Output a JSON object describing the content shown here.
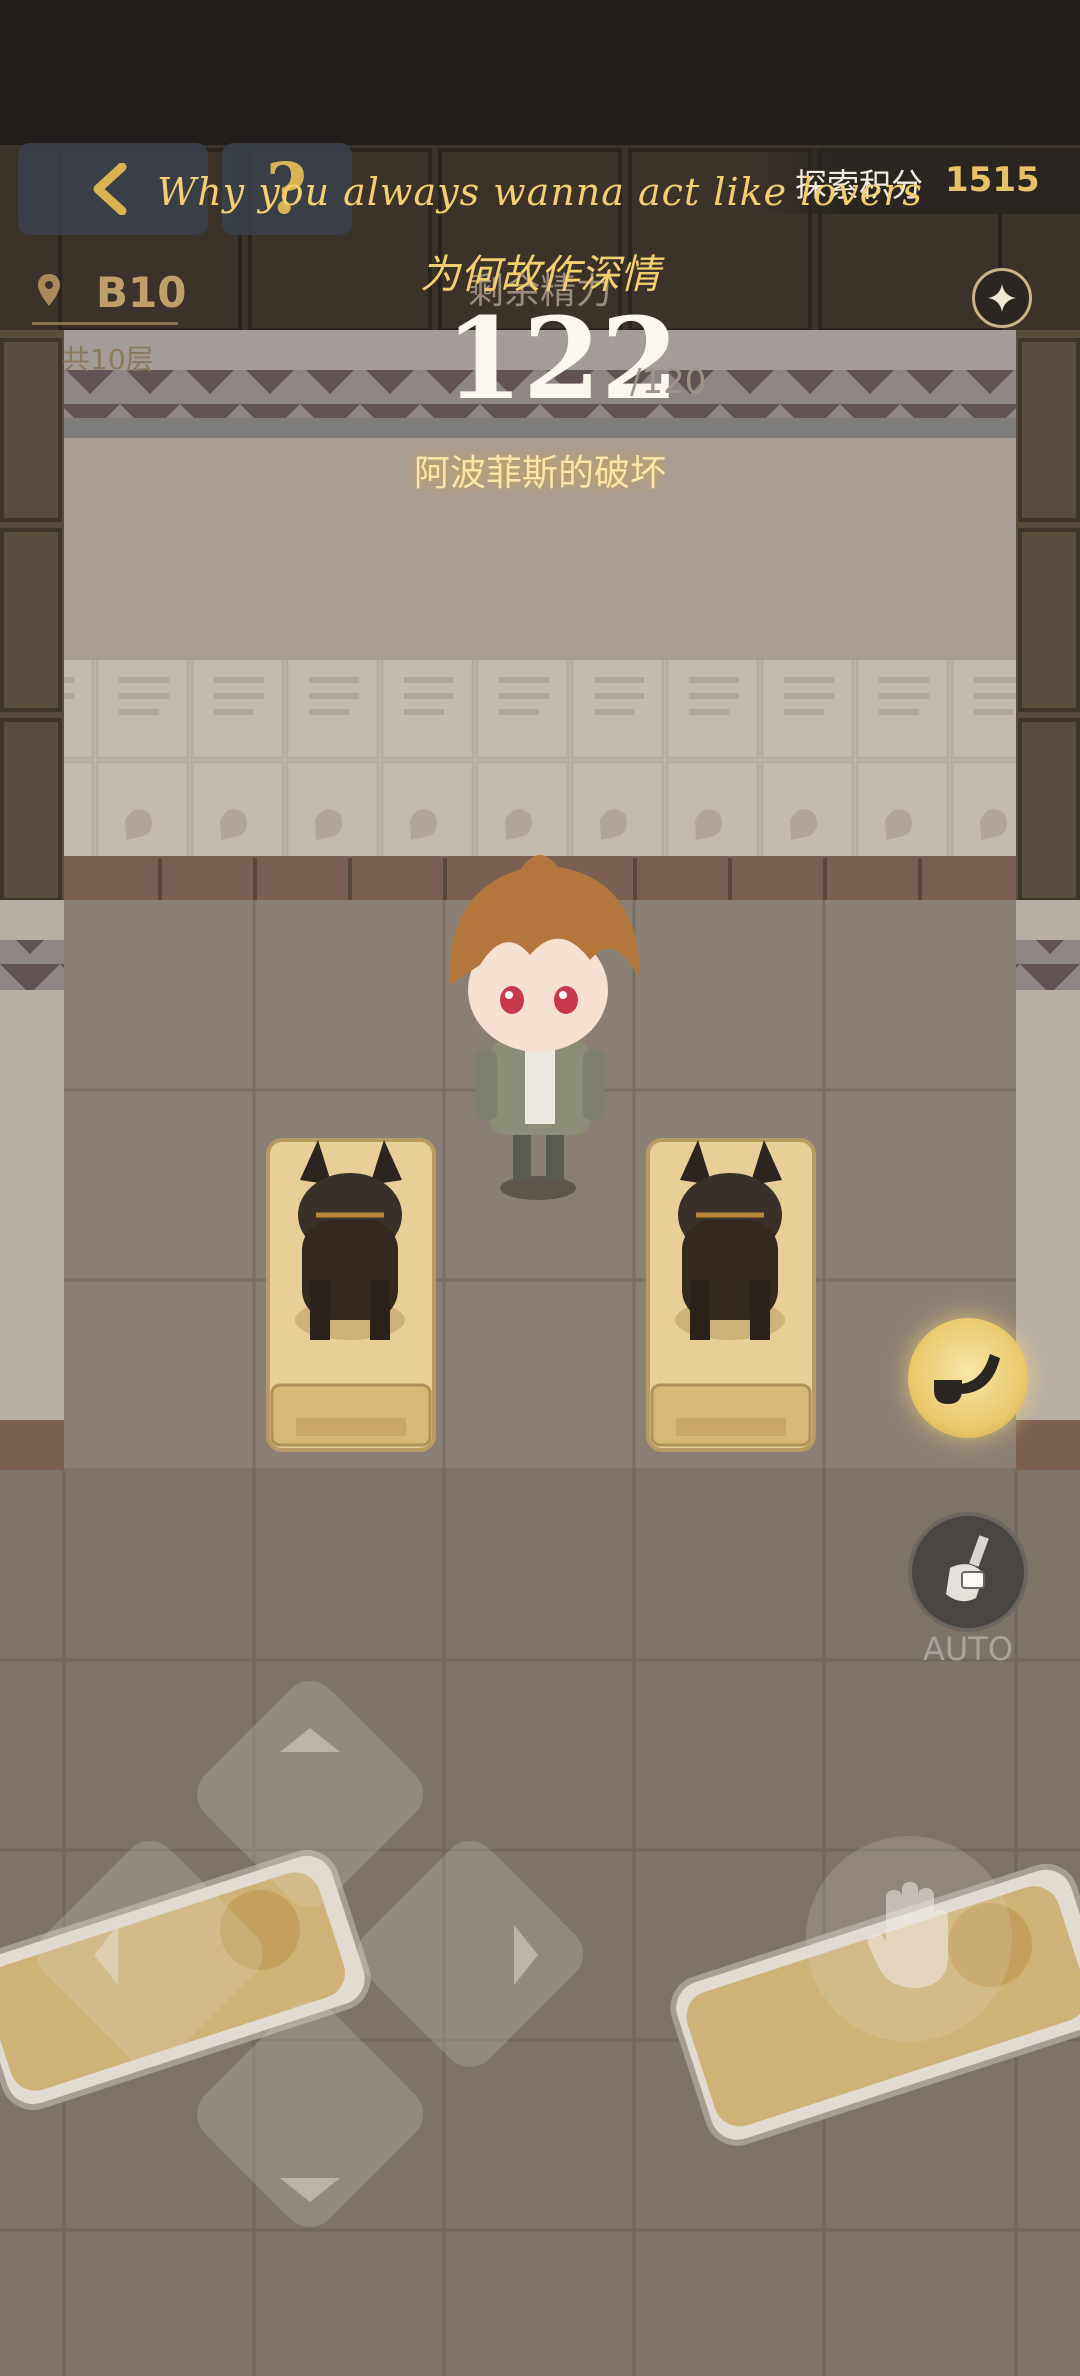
{
  "header": {
    "score_label": "探索积分",
    "score_value": "1515"
  },
  "lyrics": {
    "english": "Why you always wanna act like lovers",
    "chinese": "为何故作深情"
  },
  "floor": {
    "current": "B10",
    "total": "共10层"
  },
  "energy": {
    "title": "剩余精力",
    "current": "122",
    "max": "/120",
    "event": "阿波菲斯的破坏"
  },
  "controls": {
    "auto_label": "AUTO"
  },
  "icons": [
    "back-chevron-icon",
    "help-question-icon",
    "map-pin-icon",
    "sparkle-icon",
    "pipe-icon",
    "shovel-icon",
    "hand-icon",
    "arrow-up-icon",
    "arrow-down-icon",
    "arrow-left-icon",
    "arrow-right-icon"
  ],
  "colors": {
    "accent": "#e8c067",
    "lyric": "#f4cf70",
    "floor_tile": "#8f8478"
  }
}
